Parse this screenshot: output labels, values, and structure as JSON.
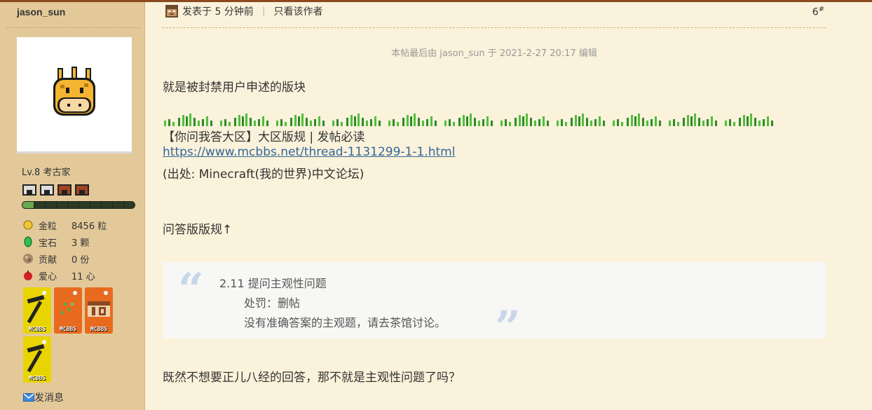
{
  "sidebar": {
    "username": "jason_sun",
    "level": "Lv.8 考古家",
    "progress_fraction": 0.1,
    "stats": [
      {
        "icon": "gold-nugget-icon",
        "label": "金粒",
        "value": "8456 粒"
      },
      {
        "icon": "emerald-icon",
        "label": "宝石",
        "value": "3 颗"
      },
      {
        "icon": "contribution-icon",
        "label": "贡献",
        "value": "0 份"
      },
      {
        "icon": "apple-heart-icon",
        "label": "爱心",
        "value": "11 心"
      }
    ],
    "medal_text": "MCBBS",
    "send_message": "发消息"
  },
  "post": {
    "posted_time": "发表于 5 分钟前",
    "only_author": "只看该作者",
    "floor_number": "6",
    "floor_suffix": "#",
    "edit_note": "本帖最后由 jason_sun 于 2021-2-27 20:17 编辑",
    "line1": "就是被封禁用户申述的版块",
    "rule_title": "【你问我答大区】大区版规 | 发帖必读",
    "rule_link": "https://www.mcbbs.net/thread-1131299-1-1.html",
    "source": "(出处: Minecraft(我的世界)中文论坛)",
    "rules_note": "问答版版规↑",
    "quote": {
      "open_mark": "“",
      "close_mark": "”",
      "title": "2.11 提问主观性问题",
      "penalty": "处罚：删帖",
      "reason": "没有准确答案的主观题，请去茶馆讨论。"
    },
    "conclusion": "既然不想要正儿八经的回答，那不就是主观性问题了吗？"
  },
  "colors": {
    "sidebar_bg": "#e3c99a",
    "main_bg": "#fbf2db",
    "link": "#336699",
    "quote_mark": "#c8d7e8"
  }
}
